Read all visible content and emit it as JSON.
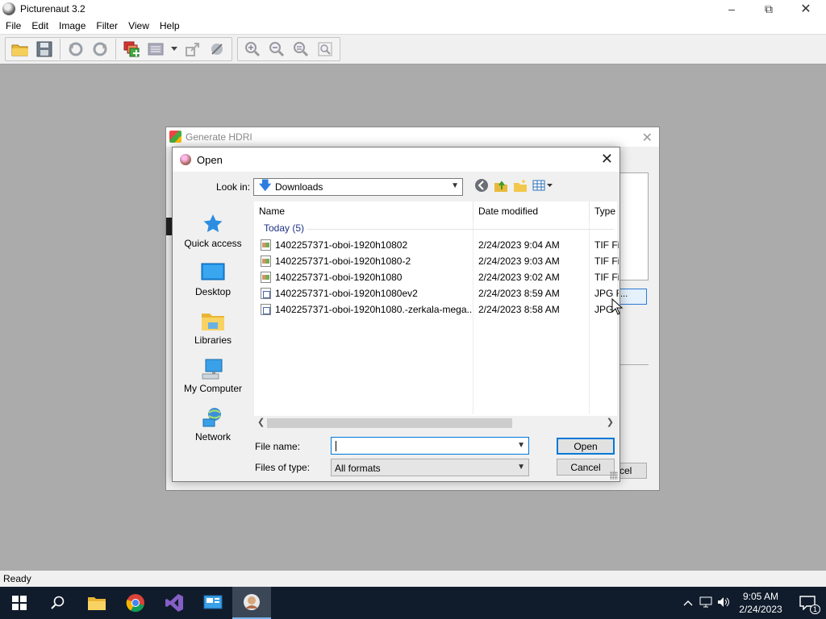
{
  "app": {
    "title": "Picturenaut 3.2",
    "menu": [
      "File",
      "Edit",
      "Image",
      "Filter",
      "View",
      "Help"
    ],
    "status": "Ready"
  },
  "hdri_dialog": {
    "title": "Generate HDRI",
    "browse_label": "...",
    "cancel_partial": "cel"
  },
  "open_dialog": {
    "title": "Open",
    "look_in_label": "Look in:",
    "look_in_value": "Downloads",
    "places": [
      {
        "label": "Quick access",
        "icon": "star-icon"
      },
      {
        "label": "Desktop",
        "icon": "desktop-icon"
      },
      {
        "label": "Libraries",
        "icon": "libraries-icon"
      },
      {
        "label": "My Computer",
        "icon": "computer-icon"
      },
      {
        "label": "Network",
        "icon": "network-icon"
      }
    ],
    "columns": [
      "Name",
      "Date modified",
      "Type"
    ],
    "group": "Today (5)",
    "files": [
      {
        "name": "1402257371-oboi-1920h10802",
        "date": "2/24/2023 9:04 AM",
        "type": "TIF Fi",
        "kind": "tif"
      },
      {
        "name": "1402257371-oboi-1920h1080-2",
        "date": "2/24/2023 9:03 AM",
        "type": "TIF Fi",
        "kind": "tif"
      },
      {
        "name": "1402257371-oboi-1920h1080",
        "date": "2/24/2023 9:02 AM",
        "type": "TIF Fi",
        "kind": "tif"
      },
      {
        "name": "1402257371-oboi-1920h1080ev2",
        "date": "2/24/2023 8:59 AM",
        "type": "JPG F",
        "kind": "jpg"
      },
      {
        "name": "1402257371-oboi-1920h1080.-zerkala-mega...",
        "date": "2/24/2023 8:58 AM",
        "type": "JPG",
        "kind": "jpg"
      }
    ],
    "file_name_label": "File name:",
    "file_name_value": "",
    "files_of_type_label": "Files of type:",
    "files_of_type_value": "All formats",
    "open_button": "Open",
    "cancel_button": "Cancel"
  },
  "taskbar": {
    "time": "9:05 AM",
    "date": "2/24/2023",
    "notification_count": "1"
  },
  "colors": {
    "accent": "#0078d7",
    "taskbar": "#101c2c",
    "workspace": "#ababab"
  }
}
